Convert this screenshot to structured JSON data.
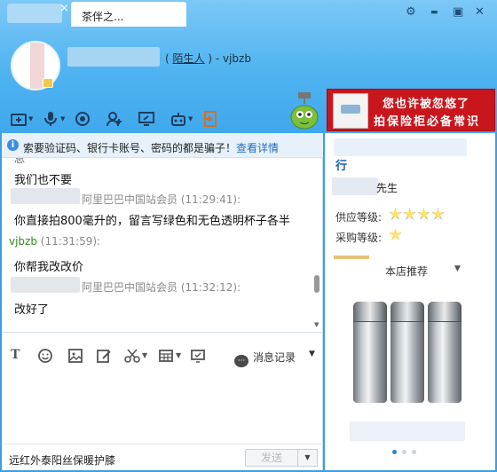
{
  "window": {
    "tab_title": "茶伴之...",
    "tab_close": "×",
    "controls": {
      "settings": "⚙",
      "minimize": "▬",
      "maximize": "▣",
      "close": "✕"
    }
  },
  "contact": {
    "stranger_label": "陌生人",
    "name_prefix": "(",
    "name_suffix": ") - vjbzb"
  },
  "ad": {
    "line1": "您也许被忽悠了",
    "line2": "拍保险柜必备常识"
  },
  "notice": {
    "icon": "i",
    "text": "索要验证码、银行卡账号、密码的都是骗子！",
    "link": "查看详情"
  },
  "messages": [
    {
      "type": "text",
      "text": "我们也不要"
    },
    {
      "type": "meta_other",
      "text": "阿里巴巴中国站会员 (11:29:41):"
    },
    {
      "type": "text",
      "text": "你直接拍800毫升的，留言写绿色和无色透明杯子各半"
    },
    {
      "type": "meta_me",
      "sender": "vjbzb",
      "time": " (11:31:59):"
    },
    {
      "type": "text",
      "text": "你帮我改改价"
    },
    {
      "type": "meta_other",
      "text": "阿里巴巴中国站会员 (11:32:12):"
    },
    {
      "type": "text",
      "text": "改好了"
    }
  ],
  "input_toolbar": {
    "history_label": "消息记录",
    "history_icon_text": "···"
  },
  "bottom": {
    "product_text": "远红外泰阳丝保暖护膝",
    "send_label": "发送",
    "send_arrow": "▼"
  },
  "right_panel": {
    "partial_char": "行",
    "name_suffix": "先生",
    "supply_level_label": "供应等级:",
    "purchase_level_label": "采购等级:",
    "supply_stars": 4,
    "purchase_stars": 1,
    "recommend_title": "本店推荐",
    "recommend_arrow": "▼",
    "carousel_pages": 3,
    "carousel_active": 1
  }
}
